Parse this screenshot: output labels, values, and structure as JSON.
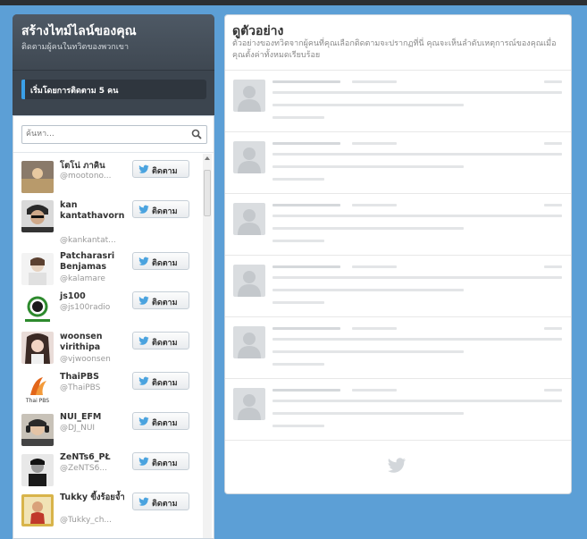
{
  "left_header": {
    "title": "สร้างไทม์ไลน์ของคุณ",
    "subtitle": "ติดตามผู้คนในทวิตของพวกเขา",
    "progress_label": "เริ่มโดยการติดตาม 5 คน"
  },
  "search": {
    "placeholder": "ค้นหา..."
  },
  "follow_label": "ติดตาม",
  "users": [
    {
      "name": "โตโน่ ภาคิน",
      "handle": "@mootono..."
    },
    {
      "name": "kan kantathavorn",
      "handle": "@kankantat..."
    },
    {
      "name": "Patcharasri Benjamas",
      "handle": "@kalamare"
    },
    {
      "name": "js100",
      "handle": "@js100radio"
    },
    {
      "name": "woonsen virithipa",
      "handle": "@vjwoonsen"
    },
    {
      "name": "ThaiPBS",
      "handle": "@ThaiPBS"
    },
    {
      "name": "NUI_EFM",
      "handle": "@DJ_NUI"
    },
    {
      "name": "ZeNTs6_PŁ",
      "handle": "@ZeNTS6..."
    },
    {
      "name": "Tukky ขี้งร้อยจ้ำ",
      "handle": "@Tukky_ch..."
    }
  ],
  "preview": {
    "title": "ดูตัวอย่าง",
    "description": "ตัวอย่างของทวิตจากผู้คนที่คุณเลือกติดตามจะปรากฏที่นี่ คุณจะเห็นลำดับเหตุการณ์ของคุณเมื่อคุณตั้งค่าทั้งหมดเรียบร้อย"
  },
  "colors": {
    "background": "#5c9fd6",
    "accent": "#3aa0e8",
    "twitter_blue": "#4aa3df"
  }
}
